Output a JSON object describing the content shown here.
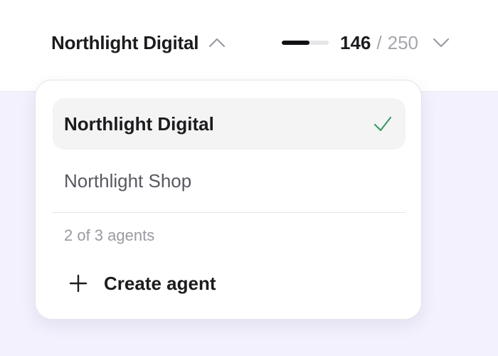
{
  "header": {
    "workspace_name": "Northlight Digital",
    "usage": {
      "used": "146",
      "separator": "/",
      "total": "250",
      "fraction": 0.584
    }
  },
  "dropdown": {
    "options": [
      {
        "label": "Northlight Digital",
        "selected": true
      },
      {
        "label": "Northlight Shop",
        "selected": false
      }
    ],
    "agents_count": "2 of 3 agents",
    "create_label": "Create agent"
  },
  "colors": {
    "page_background": "#f3f1fd",
    "check": "#3f9a68",
    "selected_row": "#f4f4f5",
    "muted_text": "#a6a6ad"
  },
  "icons": {
    "workspace_toggle": "chevron-up-icon",
    "usage_menu": "chevron-down-icon",
    "selected_marker": "check-icon",
    "create": "plus-icon"
  }
}
